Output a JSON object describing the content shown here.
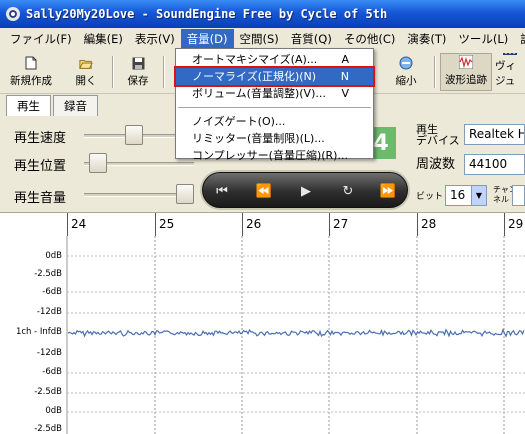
{
  "window": {
    "title": "Sally20My20Love - SoundEngine Free by Cycle of 5th"
  },
  "menubar": [
    "ファイル(F)",
    "編集(E)",
    "表示(V)",
    "音量(D)",
    "空間(S)",
    "音質(Q)",
    "その他(C)",
    "演奏(T)",
    "ツール(L)",
    "設"
  ],
  "toolbar": {
    "new_label": "新規作成",
    "open_label": "開く",
    "save_label": "保存",
    "cut_label": "縮小",
    "waveform_label": "波形追跡",
    "visual_label": "ヴィジュ"
  },
  "tabs": [
    "再生",
    "録音"
  ],
  "controls": {
    "speed_label": "再生速度",
    "position_label": "再生位置",
    "volume_label": "再生音量",
    "speed_value": "4",
    "speed_position": 0.5,
    "position_position": 0.05,
    "volume_position": 1.0
  },
  "info": {
    "device_label_1": "再生",
    "device_label_2": "デバイス",
    "device_value": "Realtek HD",
    "freq_label": "周波数",
    "freq_value": "44100",
    "bit_label": "ビット",
    "bit_value": "16",
    "channel_label_1": "チャン",
    "channel_label_2": "ネル"
  },
  "ruler": [
    "24",
    "25",
    "26",
    "27",
    "28",
    "29"
  ],
  "waveform": {
    "db_labels": [
      "0dB",
      "-2.5dB",
      "-6dB",
      "-12dB",
      "1ch - InfdB",
      "-12dB",
      "-6dB",
      "-2.5dB",
      "0dB",
      "-2.5dB"
    ]
  },
  "dropdown": {
    "items": [
      {
        "label": "オートマキシマイズ(A)...",
        "shortcut": "A"
      },
      {
        "label": "ノーマライズ(正規化)(N)",
        "shortcut": "N",
        "highlighted": true
      },
      {
        "label": "ボリューム(音量調整)(V)...",
        "shortcut": "V"
      },
      {
        "label": "ノイズゲート(O)..."
      },
      {
        "label": "リミッター(音量制限)(L)..."
      },
      {
        "label": "コンプレッサー(音量圧縮)(R)..."
      }
    ]
  },
  "colors": {
    "titlebar": "#1557d6",
    "highlight": "#316ac5",
    "waveform": "#4a6fb5",
    "speed_display": "#6bbb6b"
  }
}
